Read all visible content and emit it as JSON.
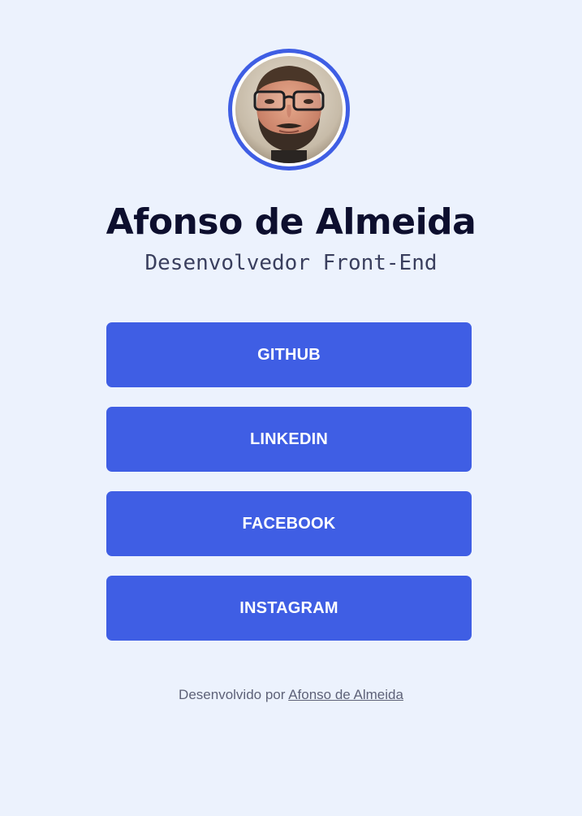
{
  "profile": {
    "avatar_label": "avatar photo",
    "name": "Afonso de Almeida",
    "role": "Desenvolvedor Front-End",
    "accent_color": "#3f5ee4"
  },
  "links": [
    {
      "label": "GITHUB"
    },
    {
      "label": "LINKEDIN"
    },
    {
      "label": "FACEBOOK"
    },
    {
      "label": "INSTAGRAM"
    }
  ],
  "footer": {
    "prefix": "Desenvolvido por ",
    "author_link": "Afonso de Almeida"
  }
}
